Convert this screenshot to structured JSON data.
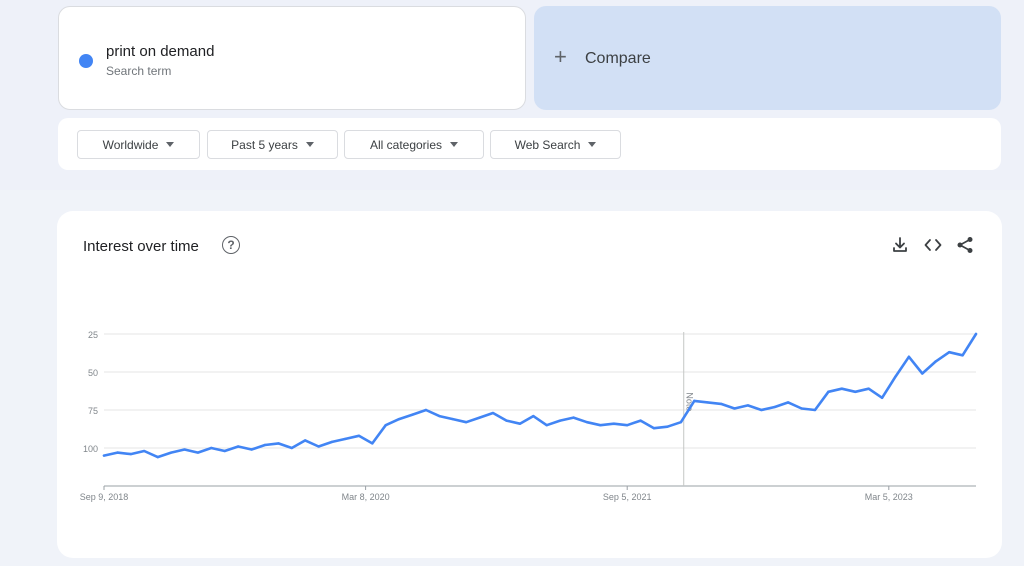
{
  "search": {
    "term": "print on demand",
    "subtitle": "Search term",
    "compare_label": "Compare",
    "dot_color": "#4285f4"
  },
  "filters": [
    {
      "label": "Worldwide"
    },
    {
      "label": "Past 5 years"
    },
    {
      "label": "All categories"
    },
    {
      "label": "Web Search"
    }
  ],
  "chart_card": {
    "title": "Interest over time",
    "help_icon": "help-icon",
    "tools": [
      "download-icon",
      "embed-code-icon",
      "share-icon"
    ],
    "note_label": "Note"
  },
  "chart_data": {
    "type": "line",
    "title": "Interest over time",
    "xlabel": "",
    "ylabel": "",
    "x_tick_labels": [
      "Sep 9, 2018",
      "Mar 8, 2020",
      "Sep 5, 2021",
      "Mar 5, 2023"
    ],
    "y_tick_labels": [
      "100",
      "75",
      "50",
      "25"
    ],
    "yticks": [
      25,
      50,
      75,
      100
    ],
    "ylim": [
      0,
      100
    ],
    "xlim": [
      "2018-09-09",
      "2023-09-03"
    ],
    "grid": true,
    "line_color": "#4285f4",
    "annotation": {
      "label": "Note",
      "date": "2022-01-01"
    },
    "series": [
      {
        "dates": [
          "2018-09-09",
          "2018-10-07",
          "2018-11-04",
          "2018-12-02",
          "2018-12-30",
          "2019-01-27",
          "2019-02-24",
          "2019-03-24",
          "2019-04-21",
          "2019-05-19",
          "2019-06-16",
          "2019-07-14",
          "2019-08-11",
          "2019-09-08",
          "2019-10-06",
          "2019-11-03",
          "2019-12-01",
          "2019-12-29",
          "2020-01-26",
          "2020-02-23",
          "2020-03-22",
          "2020-04-19",
          "2020-05-17",
          "2020-06-14",
          "2020-07-12",
          "2020-08-09",
          "2020-09-06",
          "2020-10-04",
          "2020-11-01",
          "2020-11-29",
          "2020-12-27",
          "2021-01-24",
          "2021-02-21",
          "2021-03-21",
          "2021-04-18",
          "2021-05-16",
          "2021-06-13",
          "2021-07-11",
          "2021-08-08",
          "2021-09-05",
          "2021-10-03",
          "2021-10-31",
          "2021-11-28",
          "2021-12-26",
          "2022-01-23",
          "2022-02-20",
          "2022-03-20",
          "2022-04-17",
          "2022-05-15",
          "2022-06-12",
          "2022-07-10",
          "2022-08-07",
          "2022-09-04",
          "2022-10-02",
          "2022-10-30",
          "2022-11-27",
          "2022-12-25",
          "2023-01-22",
          "2023-02-19",
          "2023-03-19",
          "2023-04-16",
          "2023-05-14",
          "2023-06-11",
          "2023-07-09",
          "2023-08-06",
          "2023-09-03"
        ],
        "values": [
          20,
          22,
          21,
          23,
          19,
          22,
          24,
          22,
          25,
          23,
          26,
          24,
          27,
          28,
          25,
          30,
          26,
          29,
          31,
          33,
          28,
          40,
          44,
          47,
          50,
          46,
          44,
          42,
          45,
          48,
          43,
          41,
          46,
          40,
          43,
          45,
          42,
          40,
          41,
          40,
          43,
          38,
          39,
          42,
          56,
          55,
          54,
          51,
          53,
          50,
          52,
          55,
          51,
          50,
          62,
          64,
          62,
          64,
          58,
          72,
          85,
          74,
          82,
          88,
          86,
          100
        ]
      }
    ]
  }
}
